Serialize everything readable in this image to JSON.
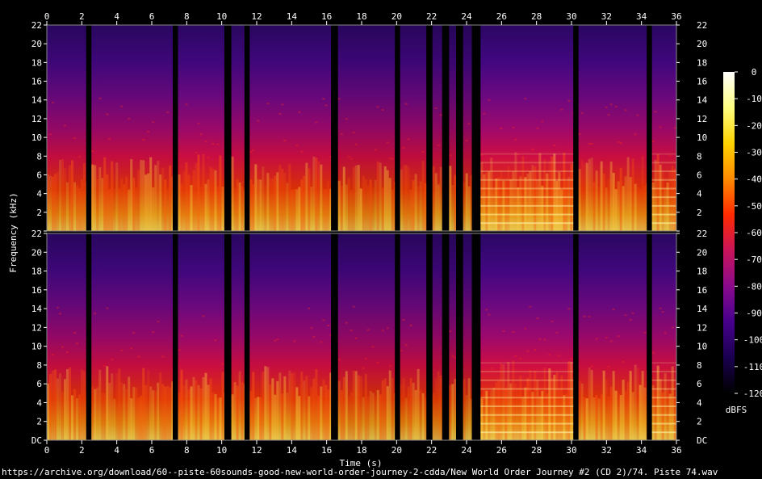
{
  "chart_data": {
    "type": "heatmap",
    "subtype": "spectrogram",
    "channels": 2,
    "xlabel": "Time (s)",
    "ylabel": "Frequency (kHz)",
    "x_ticks": [
      0,
      2,
      4,
      6,
      8,
      10,
      12,
      14,
      16,
      18,
      20,
      22,
      24,
      26,
      28,
      30,
      32,
      34,
      36
    ],
    "xlim": [
      0,
      36
    ],
    "y_ticks": [
      "DC",
      "2",
      "4",
      "6",
      "8",
      "10",
      "12",
      "14",
      "16",
      "18",
      "20",
      "22"
    ],
    "ylim_khz": [
      0,
      22
    ],
    "colorbar": {
      "label": "dBFS",
      "ticks": [
        0,
        -10,
        -20,
        -30,
        -40,
        -50,
        -60,
        -70,
        -80,
        -90,
        -100,
        -110,
        -120
      ],
      "range": [
        -120,
        0
      ],
      "colors": [
        "#000000",
        "#1a0050",
        "#46008c",
        "#8a0a8c",
        "#c8145a",
        "#ff2a00",
        "#ff8a00",
        "#ffd200",
        "#ffff80",
        "#ffffff"
      ]
    },
    "silent_gaps_s": [
      [
        2.25,
        2.55
      ],
      [
        7.2,
        7.5
      ],
      [
        10.15,
        10.55
      ],
      [
        11.3,
        11.6
      ],
      [
        16.25,
        16.65
      ],
      [
        19.9,
        20.2
      ],
      [
        21.7,
        22.05
      ],
      [
        22.6,
        23.0
      ],
      [
        23.4,
        23.8
      ],
      [
        24.3,
        24.8
      ],
      [
        30.1,
        30.4
      ],
      [
        34.3,
        34.6
      ]
    ],
    "segments": [
      {
        "start": 0.0,
        "end": 2.25,
        "energy": 0.62
      },
      {
        "start": 2.55,
        "end": 7.2,
        "energy": 0.64
      },
      {
        "start": 7.5,
        "end": 10.15,
        "energy": 0.72
      },
      {
        "start": 10.55,
        "end": 11.3,
        "energy": 0.66
      },
      {
        "start": 11.6,
        "end": 16.25,
        "energy": 0.66
      },
      {
        "start": 16.65,
        "end": 19.9,
        "energy": 0.58
      },
      {
        "start": 20.2,
        "end": 21.7,
        "energy": 0.6
      },
      {
        "start": 22.05,
        "end": 22.6,
        "energy": 0.56
      },
      {
        "start": 23.0,
        "end": 23.4,
        "energy": 0.5
      },
      {
        "start": 23.8,
        "end": 24.3,
        "energy": 0.5
      },
      {
        "start": 24.8,
        "end": 30.1,
        "energy": 0.75
      },
      {
        "start": 30.4,
        "end": 34.3,
        "energy": 0.68
      },
      {
        "start": 34.6,
        "end": 36.0,
        "energy": 0.7
      }
    ]
  },
  "footer": {
    "url": "https://archive.org/download/60--piste-60sounds-good-new-world-order-journey-2-cdda/New World Order Journey #2 (CD 2)/74. Piste 74.wav"
  }
}
